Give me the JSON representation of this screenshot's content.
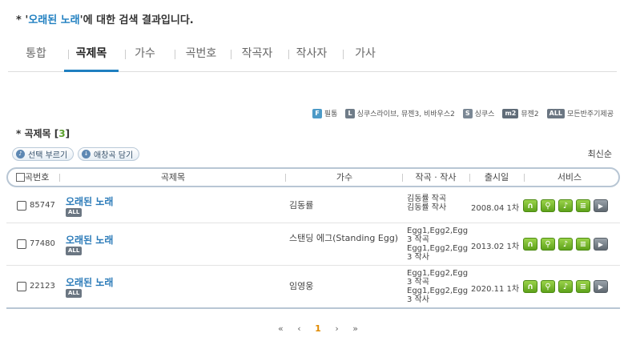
{
  "headline": {
    "prefix": "* '",
    "keyword": "오래된 노래",
    "suffix": "'에 대한 검색 결과입니다."
  },
  "tabs": [
    {
      "label": "통합"
    },
    {
      "label": "곡제목"
    },
    {
      "label": "가수"
    },
    {
      "label": "곡번호"
    },
    {
      "label": "작곡자"
    },
    {
      "label": "작사자"
    },
    {
      "label": "가사"
    }
  ],
  "legend": [
    {
      "badge": "F",
      "text": "필통"
    },
    {
      "badge": "L",
      "text": "싱쿠스라이브, 뮤젠3, 비바우스2"
    },
    {
      "badge": "S",
      "text": "싱쿠스"
    },
    {
      "badge": "m2",
      "text": "뮤젠2"
    },
    {
      "badge": "ALL",
      "text": "모든반주기제공"
    }
  ],
  "section": {
    "title_prefix": "* 곡제목 [",
    "count": "3",
    "title_suffix": "]"
  },
  "buttons": {
    "select_sing": "선택 부르기",
    "add_fav": "애창곡 담기"
  },
  "sort_label": "최신순",
  "columns": {
    "number": "곡번호",
    "title": "곡제목",
    "singer": "가수",
    "composer": "작곡 · 작사",
    "release": "출시일",
    "service": "서비스"
  },
  "rows": [
    {
      "number": "85747",
      "title": "오래된 노래",
      "badge": "ALL",
      "singer": "김동률",
      "composer": "김동률 작곡\n김동률 작사",
      "release": "2008.04 1차"
    },
    {
      "number": "77480",
      "title": "오래된 노래",
      "badge": "ALL",
      "singer": "스탠딩 에그(Standing Egg)",
      "composer": "Egg1,Egg2,Egg3 작곡\nEgg1,Egg2,Egg3 작사",
      "release": "2013.02 1차"
    },
    {
      "number": "22123",
      "title": "오래된 노래",
      "badge": "ALL",
      "singer": "임영웅",
      "composer": "Egg1,Egg2,Egg3 작곡\nEgg1,Egg2,Egg3 작사",
      "release": "2020.11 1차"
    }
  ],
  "service_icons": [
    "sing-icon",
    "search-icon",
    "lyrics-icon",
    "memo-icon",
    "play-icon"
  ],
  "pager": {
    "first": "«",
    "prev": "‹",
    "current": "1",
    "next": "›",
    "last": "»"
  },
  "colors": {
    "accent": "#1f7fc0",
    "count_green": "#5aa02c",
    "service_green": "#5ea21a",
    "pager_current": "#e08a00"
  }
}
